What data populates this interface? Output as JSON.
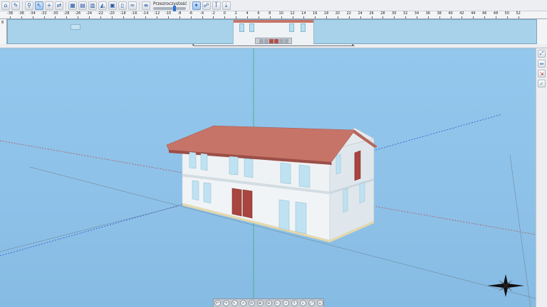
{
  "toolbar": {
    "transparency_label": "Przezroczystość",
    "buttons": [
      {
        "name": "home-view-icon",
        "glyph": "⌂"
      },
      {
        "name": "select-icon",
        "glyph": "✎"
      },
      {
        "name": "zoom-icon",
        "glyph": "⚲"
      },
      {
        "name": "select-arrow-icon",
        "glyph": "↖"
      },
      {
        "name": "add-node-icon",
        "glyph": "+"
      },
      {
        "name": "connect-icon",
        "glyph": "⇄"
      },
      {
        "name": "floor-plan-icon",
        "glyph": "▦"
      },
      {
        "name": "layer-icon",
        "glyph": "▤"
      },
      {
        "name": "wall-icon",
        "glyph": "▥"
      },
      {
        "name": "roof-icon",
        "glyph": "◭"
      },
      {
        "name": "window-icon",
        "glyph": "▣"
      },
      {
        "name": "door-icon",
        "glyph": "▯"
      },
      {
        "name": "terrain-icon",
        "glyph": "≈"
      },
      {
        "name": "stairs-icon",
        "glyph": "≡"
      }
    ],
    "right_buttons": [
      {
        "name": "render-icon",
        "glyph": "✦"
      },
      {
        "name": "walk-icon",
        "glyph": "☍"
      },
      {
        "name": "section-icon",
        "glyph": "Ī"
      },
      {
        "name": "level-down-icon",
        "glyph": "⇣"
      }
    ]
  },
  "ruler": {
    "ticks": [
      "-38",
      "-36",
      "-34",
      "-32",
      "-30",
      "-28",
      "-26",
      "-24",
      "-22",
      "-20",
      "-18",
      "-16",
      "-14",
      "-12",
      "-10",
      "-8",
      "-6",
      "-4",
      "-2",
      "0",
      "2",
      "4",
      "6",
      "8",
      "10",
      "12",
      "14",
      "16",
      "18",
      "20",
      "22",
      "24",
      "26",
      "28",
      "30",
      "32",
      "34",
      "36",
      "38",
      "40",
      "42",
      "44",
      "46",
      "48",
      "50",
      "52"
    ],
    "corner_label": "8"
  },
  "sidebar": [
    {
      "name": "zoom-extents-icon",
      "glyph": "⤢",
      "color": "blue"
    },
    {
      "name": "fit-view-icon",
      "glyph": "⇔",
      "color": "blue"
    },
    {
      "name": "export-icon",
      "glyph": "⇲",
      "color": "red"
    },
    {
      "name": "visibility-icon",
      "glyph": "✓",
      "color": "green"
    }
  ],
  "navbar": [
    "↶",
    "↷",
    "↖",
    "↗",
    "⟲",
    "⊕",
    "⊖",
    "←",
    "→",
    "↑",
    "↓",
    "⤢",
    "⌂"
  ],
  "colors": {
    "sky": "#93c7ec",
    "roof": "#c77468",
    "wall": "#eef2f4",
    "door": "#a8453f",
    "axis_red": "#b14a4a",
    "axis_blue": "#2e59c9",
    "axis_green": "#37a86b"
  }
}
